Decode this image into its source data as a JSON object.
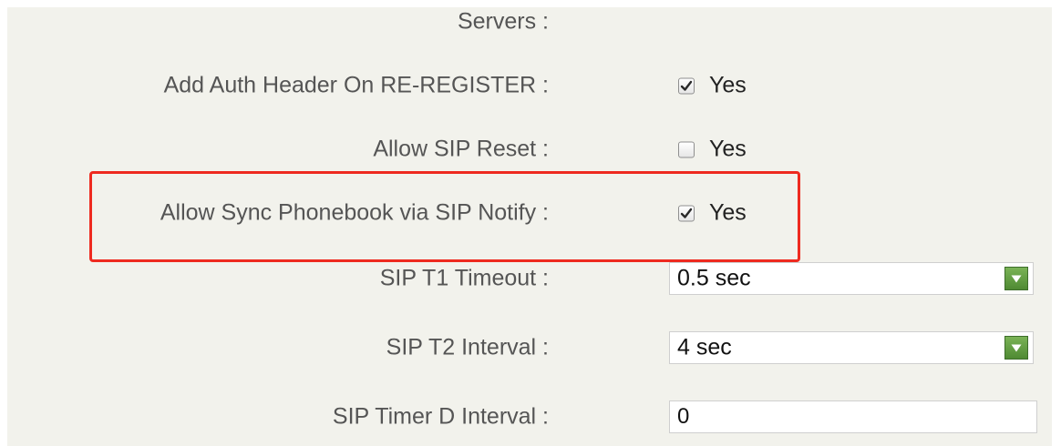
{
  "settings": {
    "servers_label": "Servers :",
    "add_auth_header": {
      "label": "Add Auth Header On RE-REGISTER :",
      "checked": true,
      "option_text": "Yes"
    },
    "allow_sip_reset": {
      "label": "Allow SIP Reset :",
      "checked": false,
      "option_text": "Yes"
    },
    "allow_sync_phonebook": {
      "label": "Allow Sync Phonebook via SIP Notify :",
      "checked": true,
      "option_text": "Yes"
    },
    "sip_t1_timeout": {
      "label": "SIP T1 Timeout :",
      "value": "0.5 sec"
    },
    "sip_t2_interval": {
      "label": "SIP T2 Interval :",
      "value": "4 sec"
    },
    "sip_timer_d_interval": {
      "label": "SIP Timer D Interval :",
      "value": "0"
    }
  },
  "icons": {
    "checkbox_check": "checkmark-icon",
    "dropdown_arrow": "triangle-down-icon"
  },
  "colors": {
    "panel_background": "#f2f2ec",
    "highlight_border": "#ee2a1f",
    "dropdown_button": "#5f9a3f"
  }
}
